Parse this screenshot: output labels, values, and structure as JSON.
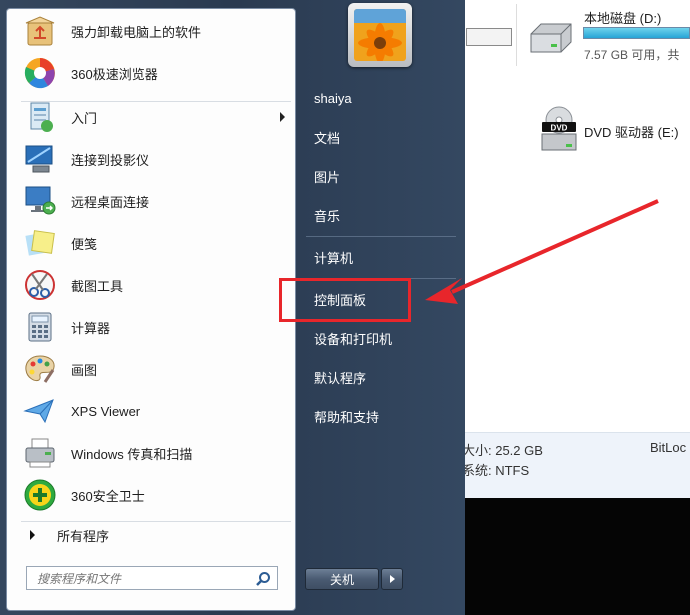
{
  "explorer": {
    "drive_d_name": "本地磁盘 (D:)",
    "drive_d_free": "7.57 GB 可用，共",
    "dvd_name": "DVD 驱动器 (E:)",
    "dvd_icon_text": "DVD",
    "detail_size": "大小: 25.2 GB",
    "detail_fs": "系统: NTFS",
    "detail_bitlocker": "BitLoc"
  },
  "start_menu": {
    "programs": [
      {
        "label": "强力卸载电脑上的软件",
        "icon": "recycle-box-icon"
      },
      {
        "label": "360极速浏览器",
        "icon": "browser-360-icon"
      },
      {
        "label": "入门",
        "icon": "getting-started-icon"
      },
      {
        "label": "连接到投影仪",
        "icon": "projector-icon"
      },
      {
        "label": "远程桌面连接",
        "icon": "remote-desktop-icon"
      },
      {
        "label": "便笺",
        "icon": "sticky-notes-icon"
      },
      {
        "label": "截图工具",
        "icon": "scissors-icon"
      },
      {
        "label": "计算器",
        "icon": "calculator-icon"
      },
      {
        "label": "画图",
        "icon": "paint-palette-icon"
      },
      {
        "label": "XPS Viewer",
        "icon": "xps-viewer-icon"
      },
      {
        "label": "Windows 传真和扫描",
        "icon": "fax-scanner-icon"
      },
      {
        "label": "360安全卫士",
        "icon": "security-360-icon"
      }
    ],
    "all_programs": "所有程序",
    "search_placeholder": "搜索程序和文件",
    "right_items": [
      "shaiya",
      "文档",
      "图片",
      "音乐",
      "计算机",
      "控制面板",
      "设备和打印机",
      "默认程序",
      "帮助和支持"
    ],
    "shutdown_label": "关机"
  },
  "colors": {
    "highlight": "#e8262b",
    "start_menu_bg": "#2f4057",
    "drive_bar": "#26a4d6"
  }
}
